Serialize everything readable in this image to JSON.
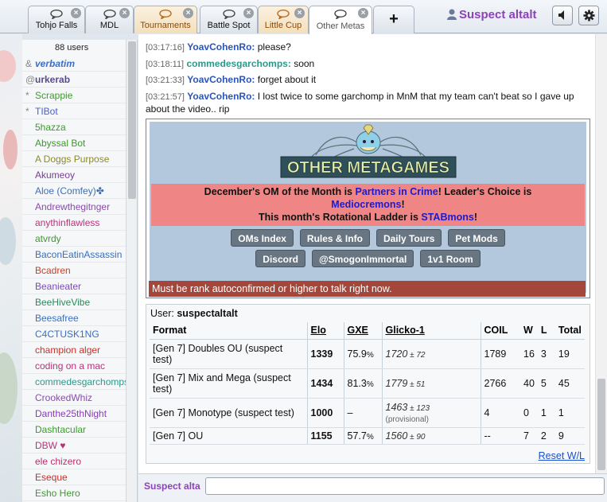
{
  "tabs": [
    {
      "label": "Tohjo Falls",
      "style": "normal"
    },
    {
      "label": "MDL",
      "style": "normal"
    },
    {
      "label": "Tournaments",
      "style": "orange"
    },
    {
      "label": "Battle Spot",
      "style": "normal"
    },
    {
      "label": "Little Cup",
      "style": "orange"
    },
    {
      "label": "Other Metas",
      "style": "active"
    }
  ],
  "newtab_label": "+",
  "header": {
    "username": "Suspect altalt"
  },
  "userlist": {
    "count": "88 users",
    "users": [
      {
        "sym": "&",
        "name": "verbatim",
        "color": "#3a6fc4",
        "style": "bi"
      },
      {
        "sym": "@",
        "name": "urkerab",
        "color": "#5a4a8c",
        "style": "b"
      },
      {
        "sym": "*",
        "name": "Scrappie",
        "color": "#3c9a2b",
        "style": ""
      },
      {
        "sym": "*",
        "name": "TIBot",
        "color": "#4a62c8",
        "style": ""
      },
      {
        "sym": "",
        "name": "5hazza",
        "color": "#3c9a2b",
        "style": ""
      },
      {
        "sym": "",
        "name": "Abyssal Bot",
        "color": "#3c9a2b",
        "style": ""
      },
      {
        "sym": "",
        "name": "A Doggs Purpose",
        "color": "#8c8a2b",
        "style": ""
      },
      {
        "sym": "",
        "name": "Akumeoy",
        "color": "#7a3e9a",
        "style": ""
      },
      {
        "sym": "",
        "name": "Aloe (Comfey)✤",
        "color": "#3f6fb8",
        "style": ""
      },
      {
        "sym": "",
        "name": "Andrewthegitnger",
        "color": "#8c4ab0",
        "style": ""
      },
      {
        "sym": "",
        "name": "anythinflawless",
        "color": "#b8327a",
        "style": ""
      },
      {
        "sym": "",
        "name": "atvrdy",
        "color": "#3c9a2b",
        "style": ""
      },
      {
        "sym": "",
        "name": "BaconEatinAssassin",
        "color": "#3a6fb8",
        "style": ""
      },
      {
        "sym": "",
        "name": "Bcadren",
        "color": "#c4422b",
        "style": ""
      },
      {
        "sym": "",
        "name": "Beanieater",
        "color": "#7a4ab8",
        "style": ""
      },
      {
        "sym": "",
        "name": "BeeHiveVibe",
        "color": "#2b8a5a",
        "style": ""
      },
      {
        "sym": "",
        "name": "Beesafree",
        "color": "#3a6fc4",
        "style": ""
      },
      {
        "sym": "",
        "name": "C4CTUSK1NG",
        "color": "#3a6fc4",
        "style": ""
      },
      {
        "sym": "",
        "name": "champion alger",
        "color": "#c4322b",
        "style": ""
      },
      {
        "sym": "",
        "name": "coding on a mac",
        "color": "#b8327a",
        "style": ""
      },
      {
        "sym": "",
        "name": "commedesgarchomps",
        "color": "#2b9a8a",
        "style": ""
      },
      {
        "sym": "",
        "name": "CrookedWhiz",
        "color": "#8c4ab0",
        "style": ""
      },
      {
        "sym": "",
        "name": "Danthe25thNight",
        "color": "#8c3ab8",
        "style": ""
      },
      {
        "sym": "",
        "name": "Dashtacular",
        "color": "#3c9a2b",
        "style": ""
      },
      {
        "sym": "",
        "name": "DBW ♥",
        "color": "#b8327a",
        "style": ""
      },
      {
        "sym": "",
        "name": "ele chizero",
        "color": "#b8326a",
        "style": ""
      },
      {
        "sym": "",
        "name": "Eseque",
        "color": "#c4322b",
        "style": ""
      },
      {
        "sym": "",
        "name": "Esho Hero",
        "color": "#3c9a2b",
        "style": ""
      }
    ]
  },
  "messages": [
    {
      "time": "[03:17:16]",
      "user": "YoavCohenRo:",
      "color": "#2a55b8",
      "text": "please?"
    },
    {
      "time": "[03:18:11]",
      "user": "commedesgarchomps:",
      "color": "#2b9a8a",
      "text": "soon"
    },
    {
      "time": "[03:21:33]",
      "user": "YoavCohenRo:",
      "color": "#2a55b8",
      "text": "forget about it"
    },
    {
      "time": "[03:21:57]",
      "user": "YoavCohenRo:",
      "color": "#2a55b8",
      "text": "I lost twice to some garchomp in MnM that my team can't beat so I gave up about the video.. rip"
    }
  ],
  "om_box": {
    "logo_text": "OTHER METAGAMES",
    "line1_a": "December's OM of the Month is ",
    "line1_link": "Partners in Crime",
    "line1_b": "! Leader's Choice is",
    "line2_link": "Mediocremons",
    "line2_b": "!",
    "line3_a": "This month's Rotational Ladder is ",
    "line3_link": "STABmons",
    "line3_b": "!",
    "buttons_row1": [
      "OMs Index",
      "Rules & Info",
      "Daily Tours",
      "Pet Mods"
    ],
    "buttons_row2": [
      "Discord",
      "@SmogonImmortal",
      "1v1 Room"
    ]
  },
  "warning": "Must be rank autoconfirmed or higher to talk right now.",
  "ratings": {
    "user_label": "User:",
    "user": "suspectaltalt",
    "headers": [
      "Format",
      "Elo",
      "GXE",
      "Glicko-1",
      "COIL",
      "W",
      "L",
      "Total"
    ],
    "rows": [
      {
        "format": "[Gen 7] Doubles OU (suspect test)",
        "elo": "1339",
        "gxe": "75.9",
        "gxe_pct": "%",
        "glicko": "1720",
        "glicko_dev": " ± 72",
        "provisional": "",
        "coil": "1789",
        "w": "16",
        "l": "3",
        "total": "19"
      },
      {
        "format": "[Gen 7] Mix and Mega (suspect test)",
        "elo": "1434",
        "gxe": "81.3",
        "gxe_pct": "%",
        "glicko": "1779",
        "glicko_dev": " ± 51",
        "provisional": "",
        "coil": "2766",
        "w": "40",
        "l": "5",
        "total": "45"
      },
      {
        "format": "[Gen 7] Monotype (suspect test)",
        "elo": "1000",
        "gxe": "–",
        "gxe_pct": "",
        "glicko": "1463",
        "glicko_dev": " ± 123",
        "provisional": "(provisional)",
        "coil": "4",
        "w": "0",
        "l": "1",
        "total": "1"
      },
      {
        "format": "[Gen 7] OU",
        "elo": "1155",
        "gxe": "57.7",
        "gxe_pct": "%",
        "glicko": "1560",
        "glicko_dev": " ± 90",
        "provisional": "",
        "coil": "--",
        "w": "7",
        "l": "2",
        "total": "9"
      }
    ],
    "reset_label": "Reset W/L"
  },
  "composer": {
    "name": "Suspect alta"
  }
}
